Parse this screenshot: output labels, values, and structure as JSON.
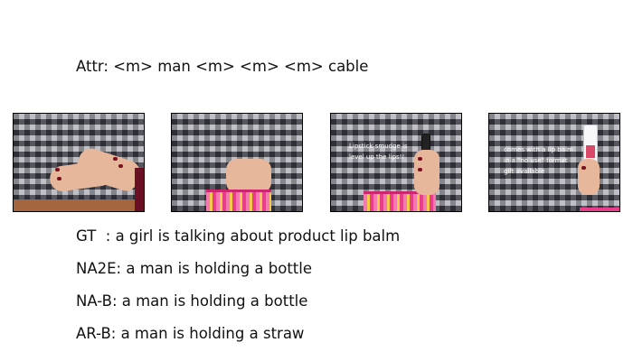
{
  "attr_line": "Attr: <m> man <m> <m> <m> cable",
  "frames": [
    {
      "caption": ""
    },
    {
      "caption": ""
    },
    {
      "caption": "Lipstick smudge is\nlevel up the lips!!"
    },
    {
      "caption": "comes with a lip balm\nin a \"no use\" format\ngift available"
    }
  ],
  "lines": {
    "gt": "GT  : a girl is talking about product lip balm",
    "na2e": "NA2E: a man is holding a bottle",
    "nab": "NA-B: a man is holding a bottle",
    "arb": "AR-B: a man is holding a straw"
  },
  "colors": {
    "pouch": "#e93d8c",
    "nail_polish": "#7a1020"
  }
}
